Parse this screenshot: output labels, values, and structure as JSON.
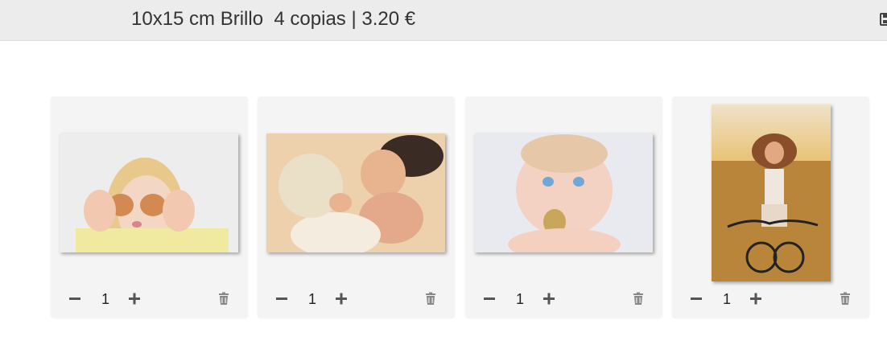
{
  "header": {
    "title": "10x15 cm Brillo  4 copias | 3.20 €"
  },
  "icons": {
    "save": "save-icon",
    "minus": "minus-icon",
    "plus": "plus-icon",
    "trash": "trash-icon"
  },
  "colors": {
    "header_bg": "#ececec",
    "card_bg": "#f4f4f4",
    "icon": "#555555"
  },
  "cards": [
    {
      "photo": "girl holding eggs over eyes",
      "orientation": "landscape",
      "quantity": "1"
    },
    {
      "photo": "parent kissing baby",
      "orientation": "landscape",
      "quantity": "1"
    },
    {
      "photo": "baby with blue eyes eating",
      "orientation": "landscape",
      "quantity": "1"
    },
    {
      "photo": "woman riding bicycle in field",
      "orientation": "portrait",
      "quantity": "1"
    }
  ]
}
